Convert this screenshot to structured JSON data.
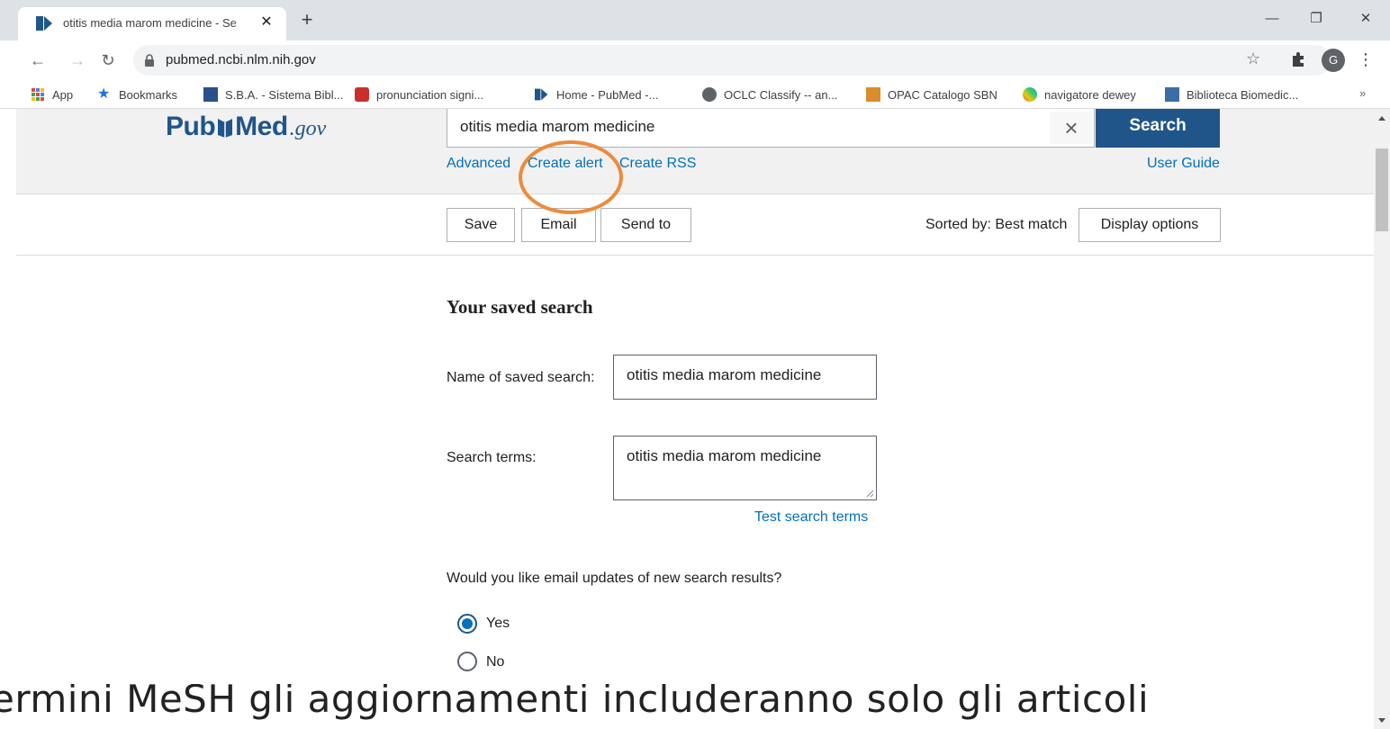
{
  "browser": {
    "tab_title": "otitis media marom medicine - Se",
    "url": "pubmed.ncbi.nlm.nih.gov",
    "profile_initial": "G",
    "bookmarks": [
      {
        "label": "App",
        "icon": "apps-grid-icon"
      },
      {
        "label": "Bookmarks",
        "icon": "star-icon"
      },
      {
        "label": "S.B.A. - Sistema Bibl...",
        "icon": "sba-icon"
      },
      {
        "label": "pronunciation signi...",
        "icon": "cambridge-icon"
      },
      {
        "label": "Home - PubMed -...",
        "icon": "pubmed-icon"
      },
      {
        "label": "OCLC Classify -- an...",
        "icon": "globe-icon"
      },
      {
        "label": "OPAC Catalogo SBN",
        "icon": "opac-icon"
      },
      {
        "label": "navigatore dewey",
        "icon": "dewey-icon"
      },
      {
        "label": "Biblioteca Biomedic...",
        "icon": "biblioteca-icon"
      }
    ],
    "more_bookmarks": "»"
  },
  "header": {
    "logo_pub": "Pub",
    "logo_med": "Med",
    "logo_gov": ".gov",
    "search_value": "otitis media marom medicine",
    "search_button": "Search",
    "links": {
      "advanced": "Advanced",
      "create_alert": "Create alert",
      "create_rss": "Create RSS",
      "user_guide": "User Guide"
    }
  },
  "actions": {
    "save": "Save",
    "email": "Email",
    "send_to": "Send to",
    "sorted_by": "Sorted by: Best match",
    "display_options": "Display options"
  },
  "saved_search": {
    "heading": "Your saved search",
    "name_label": "Name of saved search:",
    "name_value": "otitis media marom medicine",
    "terms_label": "Search terms:",
    "terms_value": "otitis media marom medicine",
    "test_link": "Test search terms",
    "email_question": "Would you like email updates of new search results?",
    "options": [
      {
        "label": "Yes",
        "selected": true
      },
      {
        "label": "No",
        "selected": false
      }
    ]
  },
  "caption": "ermini MeSH gli aggiornamenti includeranno solo gli articoli",
  "colors": {
    "pubmed_blue": "#20558a",
    "link_blue": "#0071bc",
    "highlight_orange": "#ed8b3a"
  }
}
